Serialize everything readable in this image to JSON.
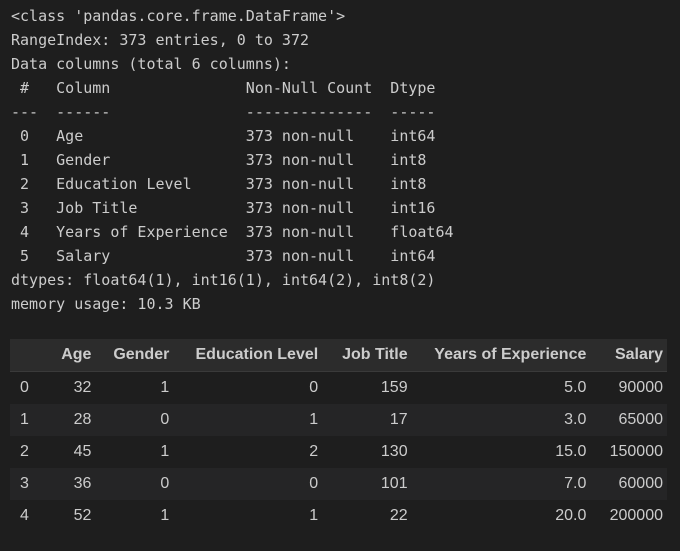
{
  "info": {
    "lines": [
      "<class 'pandas.core.frame.DataFrame'>",
      "RangeIndex: 373 entries, 0 to 372",
      "Data columns (total 6 columns):",
      " #   Column               Non-Null Count  Dtype  ",
      "---  ------               --------------  -----  ",
      " 0   Age                  373 non-null    int64  ",
      " 1   Gender               373 non-null    int8   ",
      " 2   Education Level      373 non-null    int8   ",
      " 3   Job Title            373 non-null    int16  ",
      " 4   Years of Experience  373 non-null    float64",
      " 5   Salary               373 non-null    int64  ",
      "dtypes: float64(1), int16(1), int64(2), int8(2)",
      "memory usage: 10.3 KB"
    ]
  },
  "table": {
    "columns": [
      "",
      "Age",
      "Gender",
      "Education Level",
      "Job Title",
      "Years of Experience",
      "Salary"
    ],
    "rows": [
      [
        "0",
        "32",
        "1",
        "0",
        "159",
        "5.0",
        "90000"
      ],
      [
        "1",
        "28",
        "0",
        "1",
        "17",
        "3.0",
        "65000"
      ],
      [
        "2",
        "45",
        "1",
        "2",
        "130",
        "15.0",
        "150000"
      ],
      [
        "3",
        "36",
        "0",
        "0",
        "101",
        "7.0",
        "60000"
      ],
      [
        "4",
        "52",
        "1",
        "1",
        "22",
        "20.0",
        "200000"
      ]
    ]
  }
}
